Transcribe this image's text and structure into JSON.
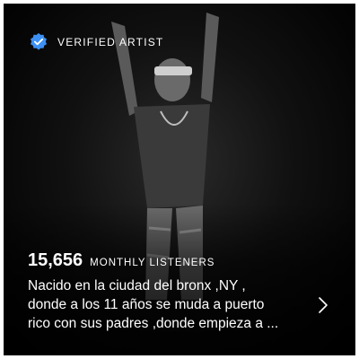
{
  "header": {
    "verified_icon": "verified-badge-icon",
    "verified_label": "VERIFIED ARTIST"
  },
  "stats": {
    "monthly_listeners_count": "15,656",
    "monthly_listeners_label": "MONTHLY LISTENERS"
  },
  "bio": {
    "line1": "Nacido en la ciudad del bronx ,NY ,",
    "line2": "donde a los 11 años se muda a puerto",
    "line3": "rico con sus padres ,donde empieza a ...",
    "more_icon": "chevron-right-icon"
  },
  "colors": {
    "background": "#000000",
    "text": "#ffffff",
    "verified_badge": "#3d91f4"
  }
}
